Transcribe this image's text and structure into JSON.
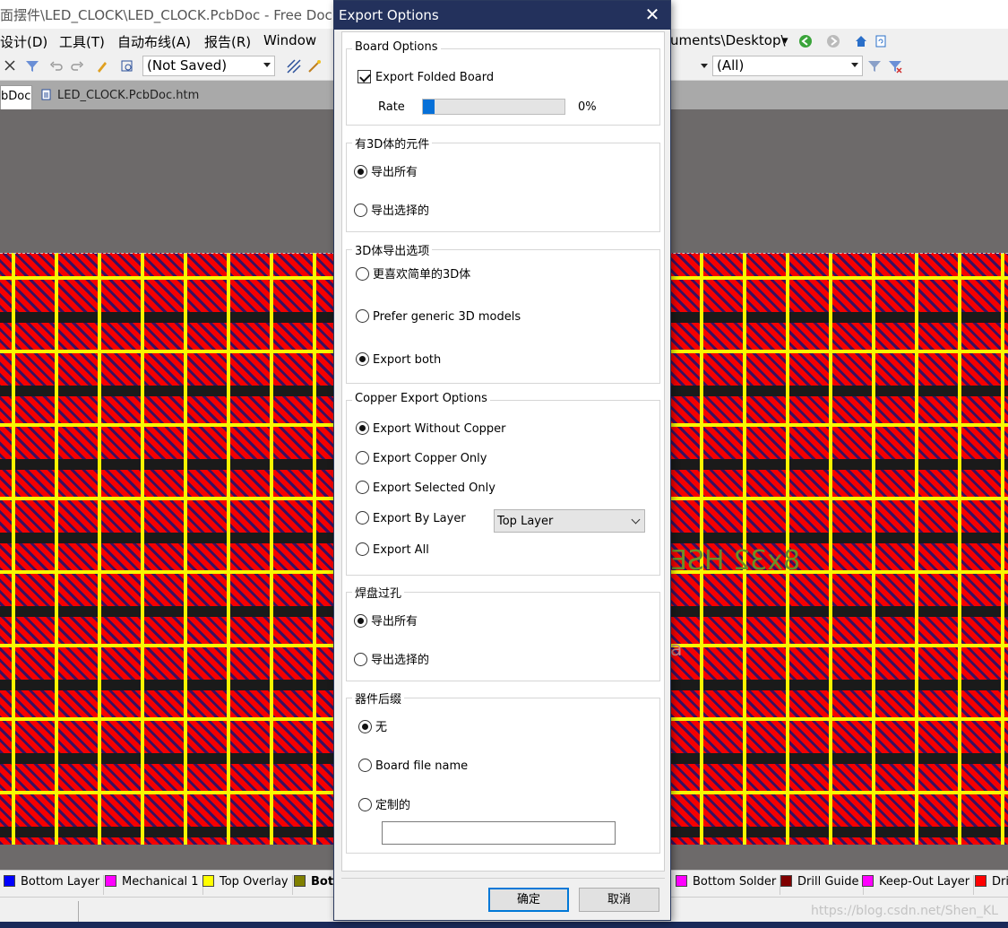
{
  "window": {
    "title": "面摆件\\LED_CLOCK\\LED_CLOCK.PcbDoc - Free Docu"
  },
  "menu": {
    "items": [
      "设计(D)",
      "工具(T)",
      "自动布线(A)",
      "报告(R)",
      "Window"
    ],
    "path": "uments\\Desktop\\"
  },
  "toolbar": {
    "saved_state": "(Not Saved)",
    "filter": "(All)"
  },
  "tabs": {
    "left_fragment": "bDoc",
    "html_tab": "LED_CLOCK.PcbDoc.htm"
  },
  "board": {
    "silkscreen_text": "8x32 HSE",
    "fragment": "a"
  },
  "layers": [
    "Bottom Layer",
    "Mechanical 1",
    "Top Overlay",
    "Bott",
    "Bottom Solder",
    "Drill Guide",
    "Keep-Out Layer",
    "Dri"
  ],
  "layer_colors": [
    "#0000ff",
    "#ff00ff",
    "#ffff00",
    "#808000",
    "#ff00ff",
    "#800000",
    "#ff00ff",
    "#ff0000"
  ],
  "watermark": "https://blog.csdn.net/Shen_KL",
  "dialog": {
    "title": "Export Options",
    "board_options": {
      "legend": "Board Options",
      "export_folded_label": "Export Folded Board",
      "export_folded_checked": true,
      "rate_label": "Rate",
      "rate_text": "0%",
      "rate_value": 0.08
    },
    "components_3d": {
      "legend": "有3D体的元件",
      "options": [
        "导出所有",
        "导出选择的"
      ],
      "selected": 0
    },
    "export_3d": {
      "legend": "3D体导出选项",
      "options": [
        "更喜欢简单的3D体",
        "Prefer generic 3D models",
        "Export both"
      ],
      "selected": 2
    },
    "copper": {
      "legend": "Copper Export Options",
      "options": [
        "Export Without Copper",
        "Export Copper Only",
        "Export Selected Only",
        "Export By Layer",
        "Export All"
      ],
      "selected": 0,
      "layer_select": "Top Layer"
    },
    "pads_vias": {
      "legend": "焊盘过孔",
      "options": [
        "导出所有",
        "导出选择的"
      ],
      "selected": 0
    },
    "suffix": {
      "legend": "器件后缀",
      "options": [
        "无",
        "Board file name",
        "定制的"
      ],
      "selected": 0,
      "custom_value": ""
    },
    "ok_label": "确定",
    "cancel_label": "取消"
  }
}
